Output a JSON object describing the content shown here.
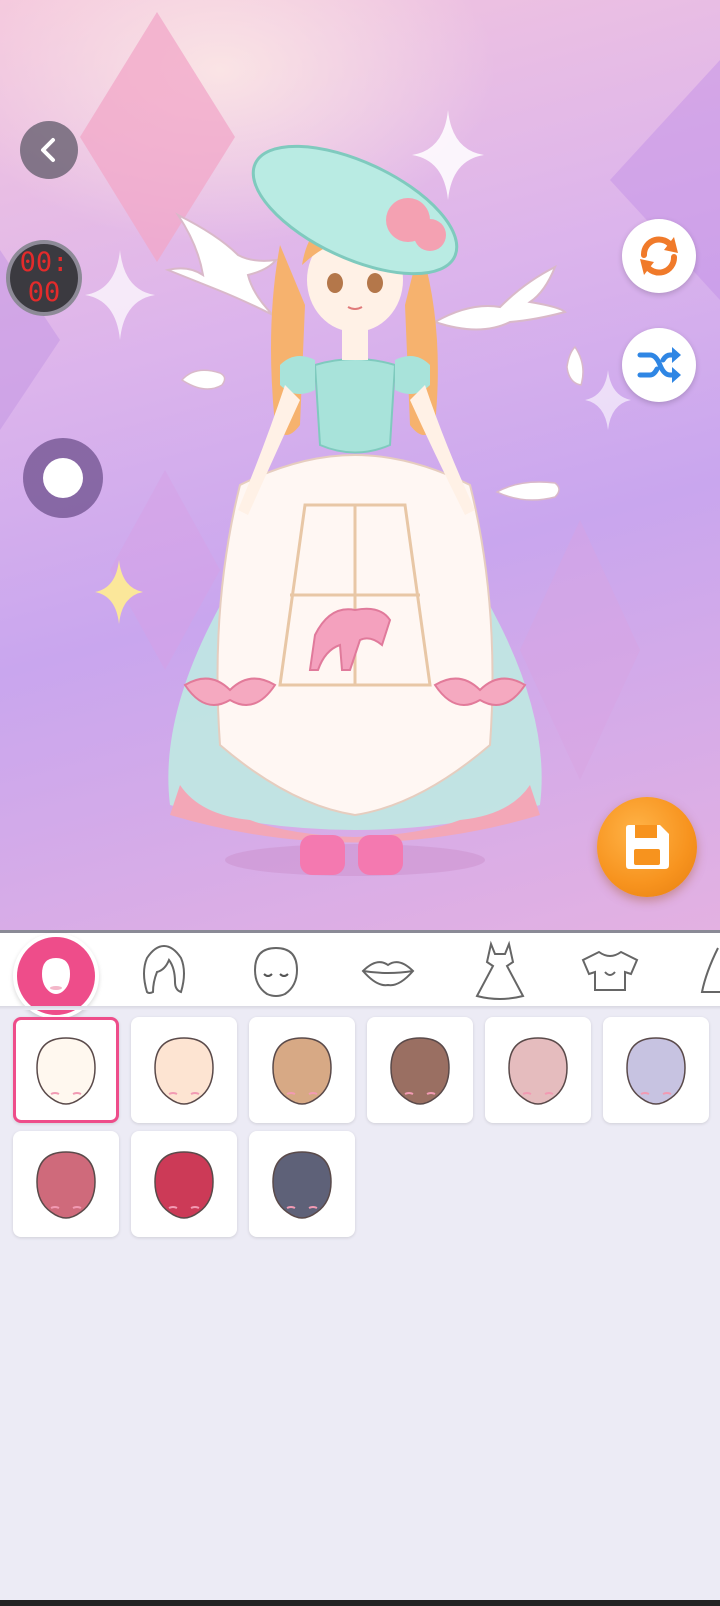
{
  "timer": {
    "value": "00:00"
  },
  "colors": {
    "accent": "#ee4d8a",
    "save": "#f7931e",
    "timer_text": "#e32b2b",
    "refresh_icon": "#f07a2a",
    "shuffle_icon": "#2f86e4"
  },
  "buttons": {
    "back": {
      "icon": "chevron-left-icon"
    },
    "refresh": {
      "icon": "refresh-icon"
    },
    "shuffle": {
      "icon": "shuffle-icon"
    },
    "save": {
      "icon": "floppy-disk-icon"
    },
    "toggle": {
      "icon": "toggle-knob"
    }
  },
  "tabs": [
    {
      "id": "skin",
      "icon": "face-skin-icon",
      "selected": true
    },
    {
      "id": "hair",
      "icon": "hair-icon",
      "selected": false
    },
    {
      "id": "face",
      "icon": "face-icon",
      "selected": false
    },
    {
      "id": "mouth",
      "icon": "lips-icon",
      "selected": false
    },
    {
      "id": "dress",
      "icon": "dress-icon",
      "selected": false
    },
    {
      "id": "top",
      "icon": "top-icon",
      "selected": false
    },
    {
      "id": "more",
      "icon": "more-icon",
      "selected": false
    }
  ],
  "skin_tones": [
    {
      "color": "#fff8ef",
      "selected": true
    },
    {
      "color": "#fde4d2",
      "selected": false
    },
    {
      "color": "#d7a985",
      "selected": false
    },
    {
      "color": "#9a6f62",
      "selected": false
    },
    {
      "color": "#e5bcbe",
      "selected": false
    },
    {
      "color": "#c7c3e1",
      "selected": false
    },
    {
      "color": "#cf6a7b",
      "selected": false
    },
    {
      "color": "#cc3a57",
      "selected": false
    },
    {
      "color": "#5e6178",
      "selected": false
    }
  ]
}
